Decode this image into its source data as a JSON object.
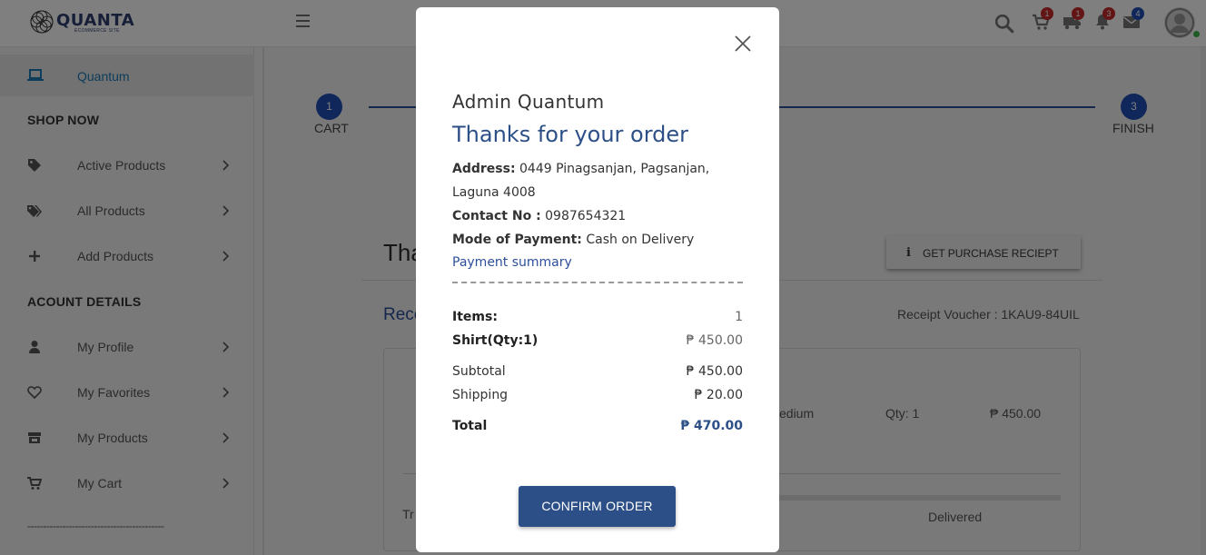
{
  "app": {
    "logo_text": "QUANTA",
    "logo_sub": "ECOMMERCE SITE"
  },
  "topbar": {
    "badges": {
      "cart": "1",
      "delivery": "1",
      "notifications": "3",
      "messages": "4"
    }
  },
  "sidebar": {
    "user_name": "Quantum",
    "section_shop": "SHOP NOW",
    "section_account": "ACOUNT DETAILS",
    "shop_items": [
      {
        "label": "Active Products",
        "icon": "tag-icon"
      },
      {
        "label": "All Products",
        "icon": "tags-icon"
      },
      {
        "label": "Add Products",
        "icon": "plus-icon"
      }
    ],
    "account_items": [
      {
        "label": "My Profile",
        "icon": "user-icon"
      },
      {
        "label": "My Favorites",
        "icon": "heart-icon"
      },
      {
        "label": "My Products",
        "icon": "store-icon"
      },
      {
        "label": "My Cart",
        "icon": "cart-icon"
      }
    ],
    "divider": "-------------------------------------------"
  },
  "stepper": {
    "steps": [
      {
        "number": "1",
        "label": "CART"
      },
      {
        "number": "3",
        "label": "FINISH"
      }
    ]
  },
  "background": {
    "title_partial": "Tha",
    "receipt_heading_partial": "Rece",
    "receipt_button": "GET PURCHASE RECIEPT",
    "voucher": "Receipt Voucher : 1KAU9-84UIL",
    "size_partial": "edium",
    "qty": "Qty: 1",
    "price": "₱ 450.00",
    "row_partial": "Tr",
    "status": "Delivered"
  },
  "modal": {
    "user": "Admin Quantum",
    "heading": "Thanks for your order",
    "address_label": "Address:",
    "address_value": "0449 Pinagsanjan, Pagsanjan, Laguna 4008",
    "contact_label": "Contact No :",
    "contact_value": "0987654321",
    "payment_label": "Mode of Payment:",
    "payment_value": "Cash on Delivery",
    "summary_link": "Payment summary",
    "items_label": "Items:",
    "items_value": "1",
    "product_label": "Shirt(Qty:1)",
    "product_value": "₱ 450.00",
    "subtotal_label": "Subtotal",
    "subtotal_value": "₱ 450.00",
    "shipping_label": "Shipping",
    "shipping_value": "₱ 20.00",
    "total_label": "Total",
    "total_value": "₱ 470.00",
    "confirm_button": "CONFIRM ORDER"
  },
  "colors": {
    "accent": "#2d4f87",
    "step_blue": "#1e4fb5",
    "badge_red": "#c62828",
    "link_blue": "#1a7bb5"
  }
}
